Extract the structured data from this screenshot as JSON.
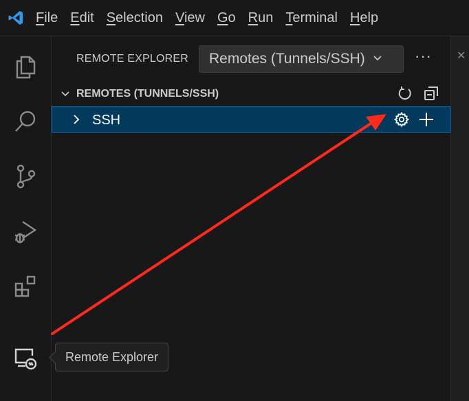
{
  "menubar": {
    "logo_icon": "vscode-logo-icon",
    "items": [
      {
        "mnemonic": "F",
        "rest": "ile"
      },
      {
        "mnemonic": "E",
        "rest": "dit"
      },
      {
        "mnemonic": "S",
        "rest": "election"
      },
      {
        "mnemonic": "V",
        "rest": "iew"
      },
      {
        "mnemonic": "G",
        "rest": "o"
      },
      {
        "mnemonic": "R",
        "rest": "un"
      },
      {
        "mnemonic": "T",
        "rest": "erminal"
      },
      {
        "mnemonic": "H",
        "rest": "elp"
      }
    ]
  },
  "activitybar": {
    "items": [
      "explorer-icon",
      "search-icon",
      "source-control-icon",
      "run-debug-icon",
      "extensions-icon",
      "remote-explorer-icon"
    ]
  },
  "sidebar": {
    "title": "REMOTE EXPLORER",
    "dropdown_value": "Remotes (Tunnels/SSH)",
    "more_label": "···",
    "section_title": "REMOTES (TUNNELS/SSH)",
    "tree_item_label": "SSH"
  },
  "tooltip": {
    "text": "Remote Explorer"
  },
  "colors": {
    "accent": "#0078d4",
    "selection": "#04395e",
    "annotation_arrow": "#ff2a1a"
  }
}
